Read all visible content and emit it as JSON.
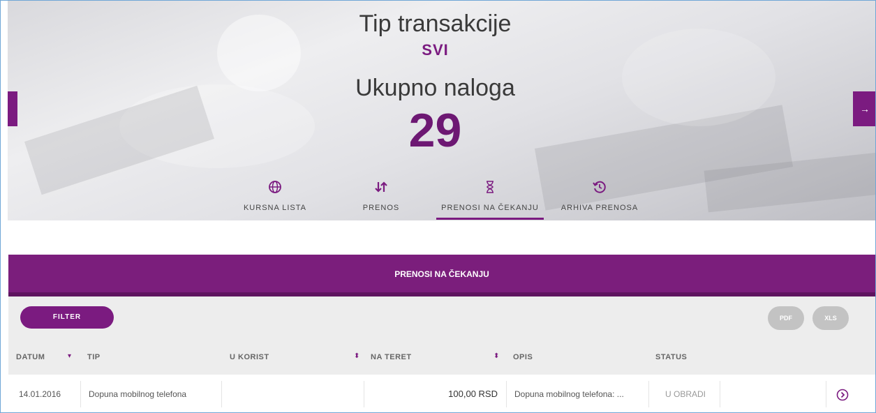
{
  "hero": {
    "title": "Tip transakcije",
    "type_value": "SVI",
    "count_label": "Ukupno naloga",
    "count_value": "29"
  },
  "nav": {
    "next_icon": "→"
  },
  "tabs": [
    {
      "label": "KURSNA LISTA",
      "icon": "globe-icon"
    },
    {
      "label": "PRENOS",
      "icon": "transfer-arrows-icon"
    },
    {
      "label": "PRENOSI NA ČEKANJU",
      "icon": "hourglass-icon",
      "active": true
    },
    {
      "label": "ARHIVA PRENOSA",
      "icon": "history-icon"
    }
  ],
  "section": {
    "title": "PRENOSI NA ČEKANJU"
  },
  "toolbar": {
    "filter_label": "FILTER",
    "pdf_label": "PDF",
    "xls_label": "XLS"
  },
  "table": {
    "columns": [
      "DATUM",
      "TIP",
      "U KORIST",
      "NA TERET",
      "OPIS",
      "STATUS"
    ],
    "rows": [
      {
        "datum": "14.01.2016",
        "tip": "Dopuna mobilnog telefona",
        "u_korist": "",
        "na_teret": "100,00 RSD",
        "opis": "Dopuna mobilnog telefona: ...",
        "status": "U OBRADI"
      }
    ]
  },
  "colors": {
    "accent": "#7b1b80",
    "accent_dark": "#5e145f",
    "panel": "#ededed",
    "button_grey": "#c3c3c3"
  }
}
